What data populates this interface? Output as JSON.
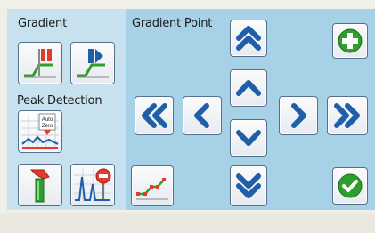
{
  "left": {
    "gradient_label": "Gradient",
    "peak_detection_label": "Peak Detection",
    "auto_zero_line1": "Auto",
    "auto_zero_line2": "Zero"
  },
  "right": {
    "gradient_point_label": "Gradient Point"
  },
  "colors": {
    "arrow_blue": "#1f5ea8",
    "add_green": "#2e9e2e",
    "check_green": "#2e9e2e",
    "flag_red": "#e23b2a",
    "flag_blue": "#1f5ea8"
  },
  "icons": [
    "gradient-red-flag-icon",
    "gradient-blue-flag-icon",
    "auto-zero-icon",
    "injection-icon",
    "peak-stop-icon",
    "gradient-points-icon",
    "double-up-arrow-icon",
    "up-arrow-icon",
    "down-arrow-icon",
    "double-down-arrow-icon",
    "double-left-arrow-icon",
    "left-arrow-icon",
    "right-arrow-icon",
    "double-right-arrow-icon",
    "add-icon",
    "check-icon"
  ]
}
